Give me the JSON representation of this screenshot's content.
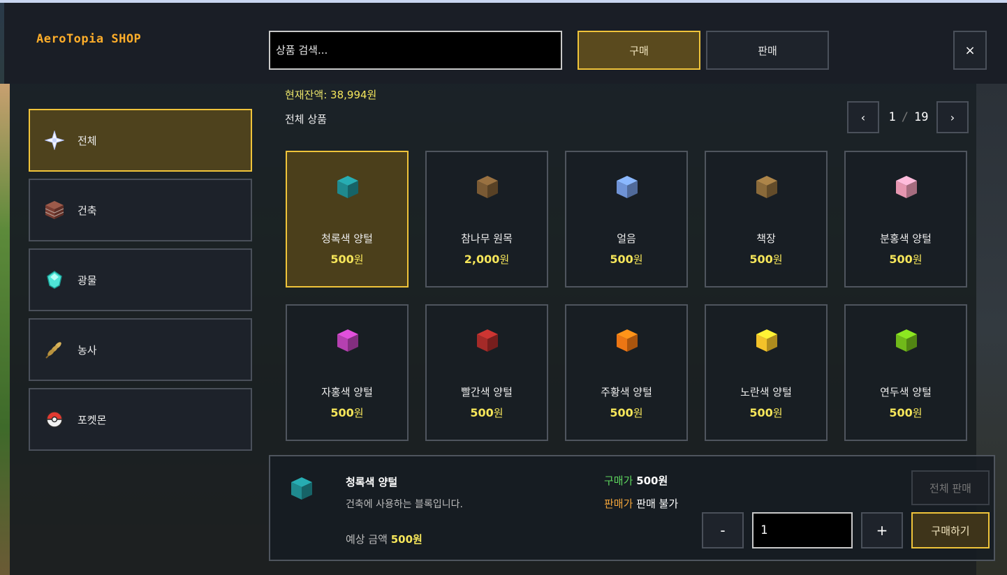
{
  "header": {
    "logo": "AeroTopia SHOP",
    "search_placeholder": "상품 검색...",
    "tab_buy": "구매",
    "tab_sell": "판매",
    "close": "×"
  },
  "sidebar": {
    "items": [
      {
        "label": "전체",
        "icon": "nether-star-icon",
        "active": true
      },
      {
        "label": "건축",
        "icon": "brick-block-icon",
        "active": false
      },
      {
        "label": "광물",
        "icon": "diamond-icon",
        "active": false
      },
      {
        "label": "농사",
        "icon": "wheat-icon",
        "active": false
      },
      {
        "label": "포켓몬",
        "icon": "pokeball-icon",
        "active": false
      }
    ]
  },
  "main": {
    "balance_label": "현재잔액:",
    "balance_value": "38,994원",
    "category_title": "전체 상품",
    "pagination": {
      "prev": "‹",
      "next": "›",
      "current": "1",
      "separator": "/",
      "total": "19"
    },
    "won": "원",
    "items": [
      {
        "name": "청록색 양털",
        "price": "500",
        "icon": "cyan-wool-icon",
        "color": "#1f8a8f",
        "active": true
      },
      {
        "name": "참나무 원목",
        "price": "2,000",
        "icon": "oak-log-icon",
        "color": "#7a5a34",
        "active": false
      },
      {
        "name": "얼음",
        "price": "500",
        "icon": "ice-icon",
        "color": "#6f93d6",
        "active": false
      },
      {
        "name": "책장",
        "price": "500",
        "icon": "bookshelf-icon",
        "color": "#8a6a3a",
        "active": false
      },
      {
        "name": "분홍색 양털",
        "price": "500",
        "icon": "pink-wool-icon",
        "color": "#e596b0",
        "active": false
      },
      {
        "name": "자홍색 양털",
        "price": "500",
        "icon": "magenta-wool-icon",
        "color": "#b540b0",
        "active": false
      },
      {
        "name": "빨간색 양털",
        "price": "500",
        "icon": "red-wool-icon",
        "color": "#a42a28",
        "active": false
      },
      {
        "name": "주황색 양털",
        "price": "500",
        "icon": "orange-wool-icon",
        "color": "#ec7614",
        "active": false
      },
      {
        "name": "노란색 양털",
        "price": "500",
        "icon": "yellow-wool-icon",
        "color": "#f2c22a",
        "active": false
      },
      {
        "name": "연두색 양털",
        "price": "500",
        "icon": "lime-wool-icon",
        "color": "#70b91a",
        "active": false
      }
    ]
  },
  "detail": {
    "name": "청록색 양털",
    "description": "건축에 사용하는 블록입니다.",
    "buy_price_label": "구매가",
    "buy_price_value": "500원",
    "sell_price_label": "판매가",
    "sell_price_value": "판매 불가",
    "estimate_label": "예상 금액",
    "estimate_value": "500원",
    "sell_all": "전체 판매",
    "minus": "-",
    "plus": "+",
    "quantity": "1",
    "purchase": "구매하기",
    "icon": "cyan-wool-icon",
    "color": "#1f8a8f"
  },
  "colors": {
    "accent": "#f0c43a",
    "price": "#f6e65a",
    "buy_label": "#5dd55d",
    "sell_label": "#f2a43a",
    "logo": "#ffae2a"
  }
}
